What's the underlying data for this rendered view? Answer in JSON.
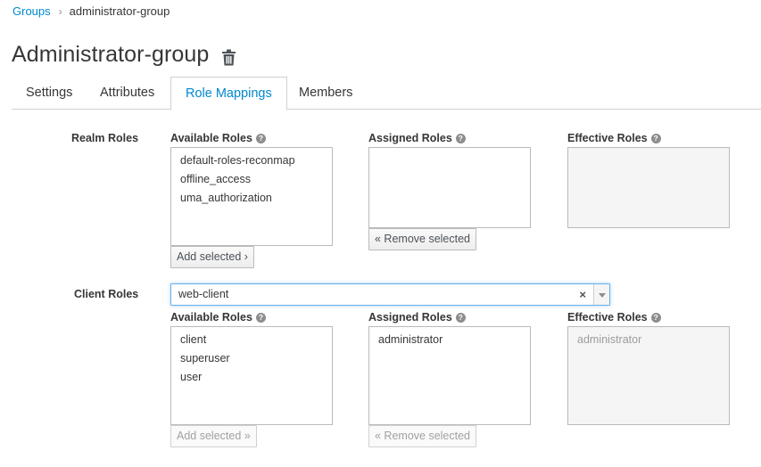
{
  "breadcrumb": {
    "parent": "Groups",
    "separator": "›",
    "current": "administrator-group"
  },
  "page": {
    "title": "Administrator-group",
    "delete_icon": "trash-icon"
  },
  "tabs": [
    {
      "label": "Settings",
      "active": false
    },
    {
      "label": "Attributes",
      "active": false
    },
    {
      "label": "Role Mappings",
      "active": true
    },
    {
      "label": "Members",
      "active": false
    }
  ],
  "realm_roles": {
    "label": "Realm Roles",
    "available_label": "Available Roles",
    "assigned_label": "Assigned Roles",
    "effective_label": "Effective Roles",
    "available": [
      "default-roles-reconmap",
      "offline_access",
      "uma_authorization"
    ],
    "assigned": [],
    "effective": [],
    "add_button": "Add selected ›",
    "remove_button": "« Remove selected"
  },
  "client_roles": {
    "label": "Client Roles",
    "client_select": {
      "value": "web-client",
      "clear_glyph": "×"
    },
    "available_label": "Available Roles",
    "assigned_label": "Assigned Roles",
    "effective_label": "Effective Roles",
    "available": [
      "client",
      "superuser",
      "user"
    ],
    "assigned": [
      "administrator"
    ],
    "effective": [
      "administrator"
    ],
    "add_button": "Add selected »",
    "remove_button": "« Remove selected"
  },
  "colors": {
    "accent": "#0088ce",
    "text": "#363636",
    "border": "#bababa"
  }
}
